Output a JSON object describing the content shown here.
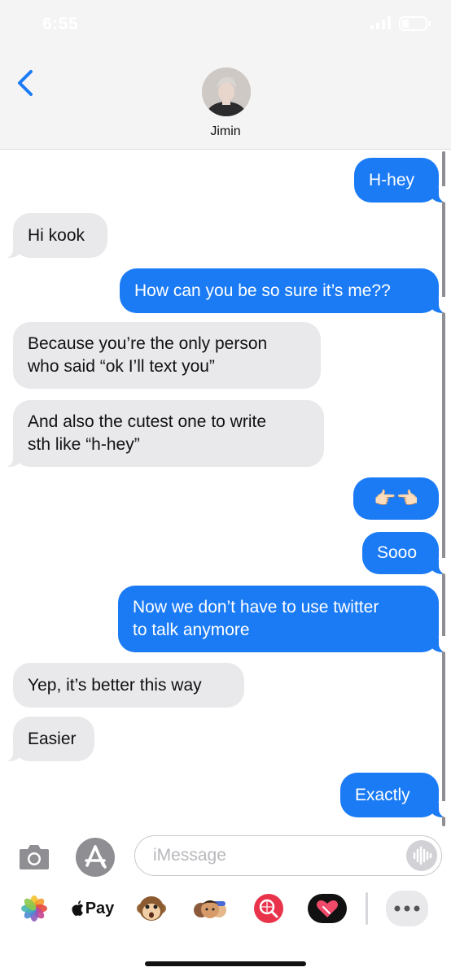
{
  "status_bar": {
    "time": "6:55"
  },
  "header": {
    "contact_name": "Jimin"
  },
  "messages": [
    {
      "side": "out",
      "text": "H-hey"
    },
    {
      "side": "in",
      "text": "Hi kook"
    },
    {
      "side": "out",
      "text": "How can you be so sure it’s me??"
    },
    {
      "side": "in",
      "text": "Because you’re the only person\nwho said “ok I’ll text you”"
    },
    {
      "side": "in",
      "text": "And also the cutest one to write\nsth like “h-hey”"
    },
    {
      "side": "out",
      "text": "👉🏻👈🏻"
    },
    {
      "side": "out",
      "text": "Sooo"
    },
    {
      "side": "out",
      "text": "Now we don’t have to use twitter\nto talk anymore"
    },
    {
      "side": "in",
      "text": "Yep, it’s better this way"
    },
    {
      "side": "in",
      "text": "Easier"
    },
    {
      "side": "out",
      "text": "Exactly"
    }
  ],
  "composer": {
    "placeholder": "iMessage"
  },
  "app_drawer": {
    "apple_pay_label": "Pay",
    "apps": [
      "photos-icon",
      "apple-pay-icon",
      "animoji-icon",
      "memoji-icon",
      "search-images-icon",
      "digital-touch-icon",
      "more-icon"
    ]
  },
  "colors": {
    "outgoing": "#1b7bf5",
    "incoming": "#e9e9ec",
    "accent": "#1b7bf5"
  }
}
